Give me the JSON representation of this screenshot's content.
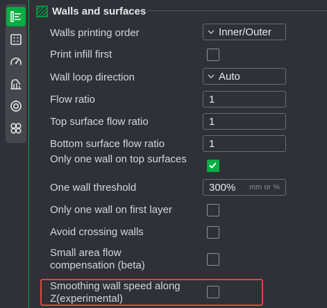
{
  "section": {
    "title": "Walls and surfaces",
    "icon": "walls-surfaces-icon"
  },
  "sidebar": {
    "items": [
      {
        "icon": "quality-layers-icon",
        "active": true
      },
      {
        "icon": "strength-grid-icon",
        "active": false
      },
      {
        "icon": "speed-gauge-icon",
        "active": false
      },
      {
        "icon": "support-icon",
        "active": false
      },
      {
        "icon": "multimaterial-target-icon",
        "active": false
      },
      {
        "icon": "others-clover-icon",
        "active": false
      }
    ]
  },
  "options": {
    "walls_printing_order": {
      "label": "Walls printing order",
      "value": "Inner/Outer"
    },
    "print_infill_first": {
      "label": "Print infill first",
      "checked": false
    },
    "wall_loop_direction": {
      "label": "Wall loop direction",
      "value": "Auto"
    },
    "flow_ratio": {
      "label": "Flow ratio",
      "value": "1"
    },
    "top_surface_flow_ratio": {
      "label": "Top surface flow ratio",
      "value": "1"
    },
    "bottom_surface_flow_ratio": {
      "label": "Bottom surface flow ratio",
      "value": "1"
    },
    "only_one_wall_top": {
      "label": "Only one wall on top surfaces",
      "checked": true
    },
    "one_wall_threshold": {
      "label": "One wall threshold",
      "value": "300%",
      "unit": "mm or %"
    },
    "only_one_wall_first_layer": {
      "label": "Only one wall on first layer",
      "checked": false
    },
    "avoid_crossing_walls": {
      "label": "Avoid crossing walls",
      "checked": false
    },
    "small_area_flow_comp": {
      "label": "Small area flow compensation (beta)",
      "checked": false
    },
    "smoothing_wall_speed": {
      "label": "Smoothing wall speed along Z(experimental)",
      "checked": false
    }
  },
  "colors": {
    "accent": "#00ae42",
    "highlight": "#e2453f",
    "background": "#2f3137"
  }
}
